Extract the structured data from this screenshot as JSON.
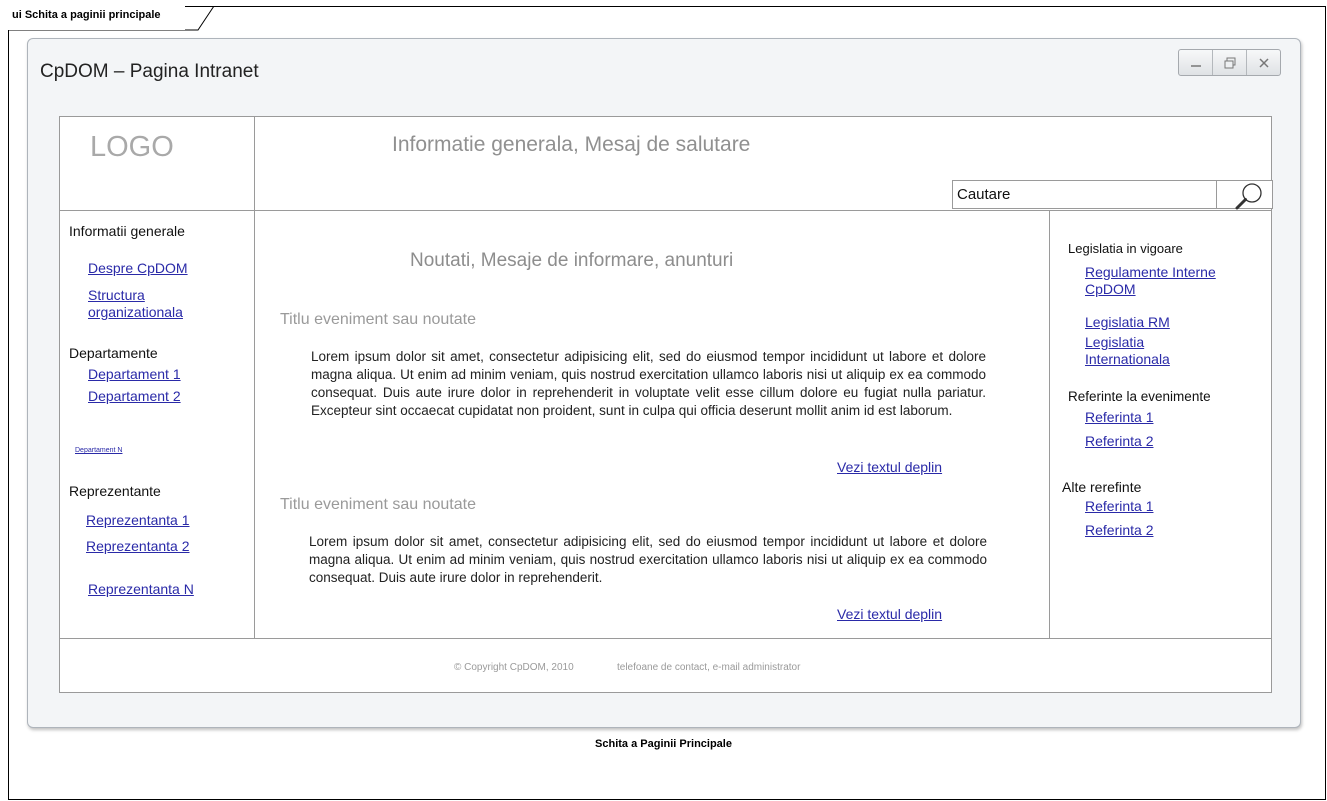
{
  "frame": {
    "tab_label": "ui Schita a paginii principale",
    "caption": "Schita a Paginii Principale"
  },
  "window": {
    "title": "CpDOM – Pagina Intranet",
    "buttons": [
      "minimize-icon",
      "restore-icon",
      "close-icon"
    ]
  },
  "header": {
    "logo": "LOGO",
    "message": "Informatie generala, Mesaj de salutare",
    "search": {
      "value": "Cautare",
      "icon": "search-icon"
    }
  },
  "left_nav": {
    "general": {
      "heading": "Informatii generale",
      "about": "Despre CpDOM",
      "structure_line1": "Structura",
      "structure_line2": "organizationala"
    },
    "departments": {
      "heading": "Departamente",
      "items": [
        "Departament 1",
        "Departament 2",
        "Departament N"
      ]
    },
    "representatives": {
      "heading": "Reprezentante",
      "items": [
        "Reprezentanta 1",
        "Reprezentanta 2",
        "Reprezentanta N"
      ]
    }
  },
  "main": {
    "title": "Noutati, Mesaje de informare, anunturi",
    "events": [
      {
        "title": "Titlu eveniment sau noutate",
        "body": "Lorem ipsum dolor sit amet, consectetur adipisicing elit, sed do eiusmod tempor incididunt ut labore et dolore magna aliqua. Ut enim ad minim veniam, quis nostrud exercitation ullamco laboris nisi ut aliquip ex ea commodo consequat. Duis aute irure dolor in reprehenderit in voluptate velit esse cillum dolore eu fugiat nulla pariatur. Excepteur sint occaecat cupidatat non proident, sunt in culpa qui officia deserunt mollit anim id est laborum.",
        "more": "Vezi textul deplin"
      },
      {
        "title": "Titlu eveniment sau noutate",
        "body": "Lorem ipsum dolor sit amet, consectetur adipisicing elit, sed do eiusmod tempor incididunt ut labore et dolore magna aliqua. Ut enim ad minim veniam, quis nostrud exercitation ullamco laboris nisi ut aliquip ex ea commodo consequat. Duis aute irure dolor in reprehenderit.",
        "more": "Vezi textul deplin"
      }
    ]
  },
  "right_nav": {
    "legislation": {
      "heading": "Legislatia in vigoare",
      "internal_line1": "Regulamente Interne",
      "internal_line2": "CpDOM",
      "rm": "Legislatia RM",
      "intl_line1": "Legislatia",
      "intl_line2": "Internationala"
    },
    "event_refs": {
      "heading": "Referinte la evenimente",
      "items": [
        "Referinta 1",
        "Referinta 2"
      ]
    },
    "other_refs": {
      "heading": "Alte rerefinte",
      "items": [
        "Referinta 1",
        "Referinta 2"
      ]
    }
  },
  "footer": {
    "copyright": "© Copyright CpDOM, 2010",
    "contacts": "telefoane de contact, e-mail administrator"
  }
}
